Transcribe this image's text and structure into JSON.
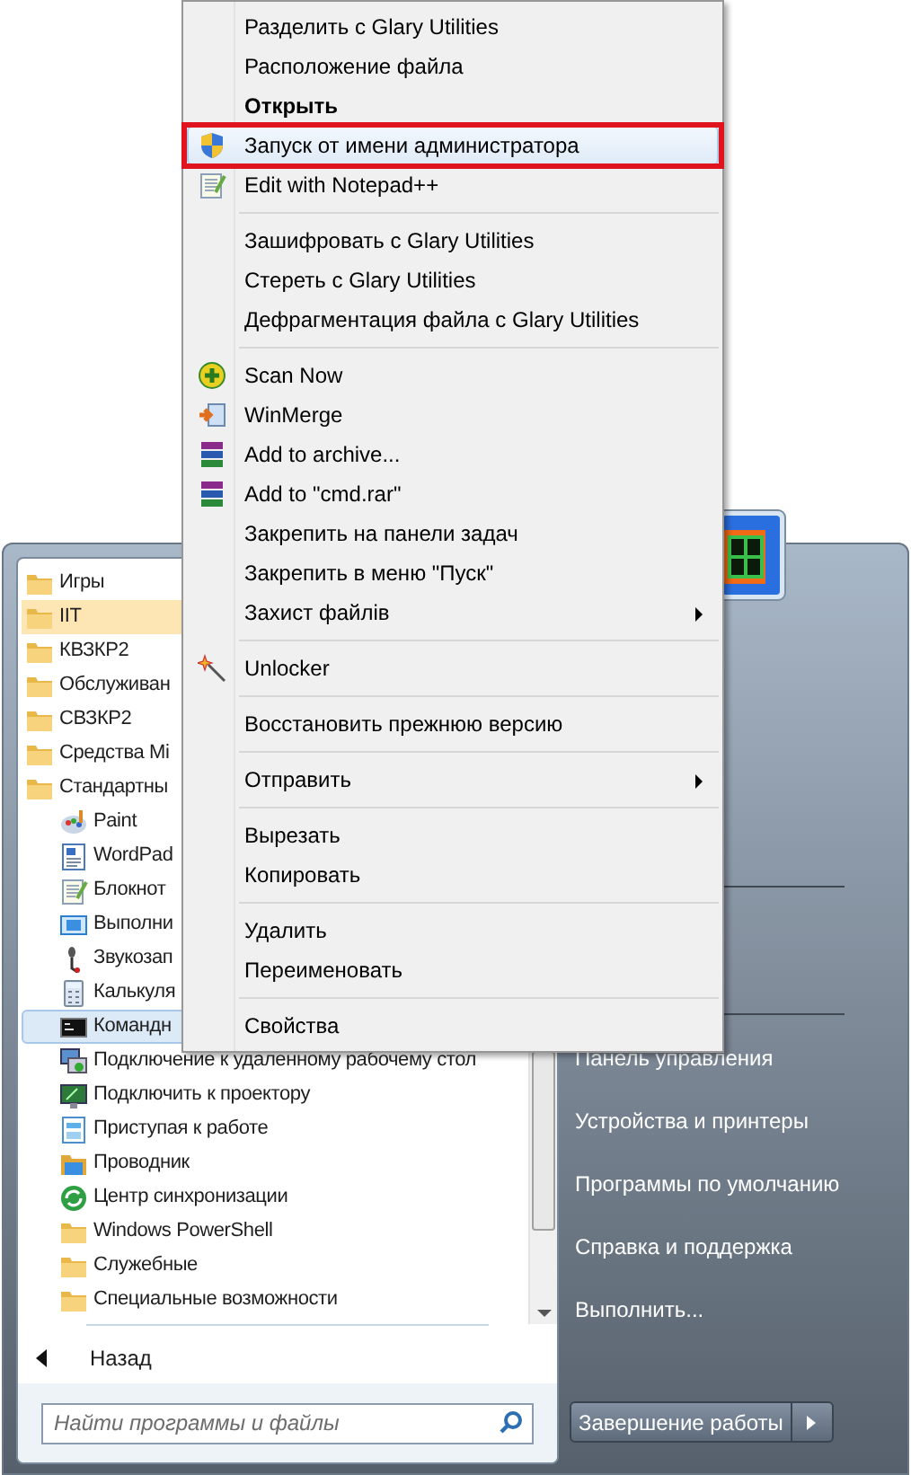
{
  "start_menu": {
    "programs": [
      {
        "label": "Игры",
        "kind": "folder",
        "new": false,
        "selected": false
      },
      {
        "label": "IIT",
        "kind": "folder",
        "new": true,
        "selected": false
      },
      {
        "label": "КВЗКР2",
        "kind": "folder",
        "new": false,
        "selected": false
      },
      {
        "label": "Обслуживан",
        "kind": "folder",
        "new": false,
        "selected": false
      },
      {
        "label": "СВЗКР2",
        "kind": "folder",
        "new": false,
        "selected": false
      },
      {
        "label": "Средства Mi",
        "kind": "folder",
        "new": false,
        "selected": false
      },
      {
        "label": "Стандартны",
        "kind": "folder",
        "new": false,
        "selected": false,
        "children": [
          {
            "label": "Paint",
            "kind": "paint",
            "new": false,
            "selected": false
          },
          {
            "label": "WordPad",
            "kind": "wordpad",
            "new": false,
            "selected": false
          },
          {
            "label": "Блокнот",
            "kind": "notepad",
            "new": false,
            "selected": false
          },
          {
            "label": "Выполни",
            "kind": "run",
            "new": false,
            "selected": false
          },
          {
            "label": "Звукозап",
            "kind": "mic",
            "new": false,
            "selected": false
          },
          {
            "label": "Калькуля",
            "kind": "calc",
            "new": false,
            "selected": false
          },
          {
            "label": "Командн",
            "kind": "cmd",
            "new": false,
            "selected": true
          },
          {
            "label": "Подключение к удаленному рабочему стол",
            "kind": "remote",
            "new": false,
            "selected": false
          },
          {
            "label": "Подключить к проектору",
            "kind": "projector",
            "new": false,
            "selected": false
          },
          {
            "label": "Приступая к работе",
            "kind": "start",
            "new": false,
            "selected": false
          },
          {
            "label": "Проводник",
            "kind": "explorer",
            "new": false,
            "selected": false
          },
          {
            "label": "Центр синхронизации",
            "kind": "sync",
            "new": false,
            "selected": false
          },
          {
            "label": "Windows PowerShell",
            "kind": "folder",
            "new": false,
            "selected": false
          },
          {
            "label": "Служебные",
            "kind": "folder",
            "new": false,
            "selected": false
          },
          {
            "label": "Специальные возможности",
            "kind": "folder",
            "new": false,
            "selected": false
          }
        ]
      }
    ],
    "back": "Назад",
    "search": {
      "placeholder": "Найти программы и файлы"
    },
    "links": [
      "Панель управления",
      "Устройства и принтеры",
      "Программы по умолчанию",
      "Справка и поддержка",
      "Выполнить..."
    ],
    "shutdown": "Завершение работы"
  },
  "context_menu": {
    "groups": [
      {
        "items": [
          {
            "label": "Разделить с Glary Utilities",
            "bold": false,
            "selected": false,
            "outlined": false,
            "submenu": false
          },
          {
            "label": "Расположение файла",
            "bold": false,
            "selected": false,
            "outlined": false,
            "submenu": false
          },
          {
            "label": "Открыть",
            "bold": true,
            "selected": false,
            "outlined": false,
            "submenu": false
          },
          {
            "label": "Запуск от имени администратора",
            "kind": "shield",
            "bold": false,
            "selected": true,
            "outlined": true,
            "submenu": false
          },
          {
            "label": "Edit with Notepad++",
            "kind": "notepad",
            "bold": false,
            "selected": false,
            "outlined": false,
            "submenu": false
          }
        ]
      },
      {
        "items": [
          {
            "label": "Зашифровать с Glary Utilities",
            "bold": false,
            "selected": false,
            "outlined": false,
            "submenu": false
          },
          {
            "label": "Стереть с Glary Utilities",
            "bold": false,
            "selected": false,
            "outlined": false,
            "submenu": false
          },
          {
            "label": "Дефрагментация файла с Glary Utilities",
            "bold": false,
            "selected": false,
            "outlined": false,
            "submenu": false
          }
        ]
      },
      {
        "items": [
          {
            "label": "Scan Now",
            "kind": "scan",
            "bold": false,
            "selected": false,
            "outlined": false,
            "submenu": false
          },
          {
            "label": "WinMerge",
            "kind": "merge",
            "bold": false,
            "selected": false,
            "outlined": false,
            "submenu": false
          },
          {
            "label": "Add to archive...",
            "kind": "books",
            "bold": false,
            "selected": false,
            "outlined": false,
            "submenu": false
          },
          {
            "label": "Add to \"cmd.rar\"",
            "kind": "books",
            "bold": false,
            "selected": false,
            "outlined": false,
            "submenu": false
          },
          {
            "label": "Закрепить на панели задач",
            "bold": false,
            "selected": false,
            "outlined": false,
            "submenu": false
          },
          {
            "label": "Закрепить в меню \"Пуск\"",
            "bold": false,
            "selected": false,
            "outlined": false,
            "submenu": false
          },
          {
            "label": "Захист файлів",
            "bold": false,
            "selected": false,
            "outlined": false,
            "submenu": true
          }
        ]
      },
      {
        "items": [
          {
            "label": "Unlocker",
            "kind": "wand",
            "bold": false,
            "selected": false,
            "outlined": false,
            "submenu": false
          }
        ]
      },
      {
        "items": [
          {
            "label": "Восстановить прежнюю версию",
            "bold": false,
            "selected": false,
            "outlined": false,
            "submenu": false
          }
        ]
      },
      {
        "items": [
          {
            "label": "Отправить",
            "bold": false,
            "selected": false,
            "outlined": false,
            "submenu": true
          }
        ]
      },
      {
        "items": [
          {
            "label": "Вырезать",
            "bold": false,
            "selected": false,
            "outlined": false,
            "submenu": false
          },
          {
            "label": "Копировать",
            "bold": false,
            "selected": false,
            "outlined": false,
            "submenu": false
          }
        ]
      },
      {
        "items": [
          {
            "label": "Удалить",
            "bold": false,
            "selected": false,
            "outlined": false,
            "submenu": false
          },
          {
            "label": "Переименовать",
            "bold": false,
            "selected": false,
            "outlined": false,
            "submenu": false
          }
        ]
      },
      {
        "items": [
          {
            "label": "Свойства",
            "bold": false,
            "selected": false,
            "outlined": false,
            "submenu": false
          }
        ]
      }
    ]
  }
}
